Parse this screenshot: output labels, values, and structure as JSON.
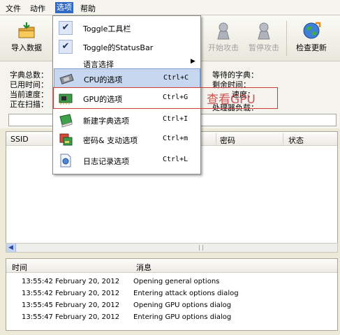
{
  "menubar": {
    "file": "文件",
    "action": "动作",
    "options": "选项",
    "help": "帮助"
  },
  "toolbar": {
    "import": "导入数据",
    "start_attack": "开始攻击",
    "pause_attack": "暂停攻击",
    "check_update": "检查更新"
  },
  "stats": {
    "dict_total": "字典总数：",
    "used_time": "已用时间：",
    "current_speed": "当前速度：",
    "scanning": "正在扫描：",
    "waiting_dict": "等待的字典：",
    "remaining_time": "剩余时间：",
    "total_speed_fragment": "速度：",
    "processor_load_fragment": "处理器负载："
  },
  "grid": {
    "columns": [
      "SSID",
      "密码",
      "状态"
    ]
  },
  "log": {
    "col_time": "时间",
    "col_message": "消息",
    "rows": [
      {
        "time": "13:55:42 February 20, 2012",
        "message": "Opening general options"
      },
      {
        "time": "13:55:42 February 20, 2012",
        "message": "Entering attack options dialog"
      },
      {
        "time": "13:55:45 February 20, 2012",
        "message": "Opening GPU options dialog"
      },
      {
        "time": "13:55:47 February 20, 2012",
        "message": "Entering GPU options dialog"
      }
    ]
  },
  "options_menu": {
    "items": [
      {
        "label": "Toggle工具栏",
        "shortcut": "",
        "checked": true
      },
      {
        "label": "Toggle的StatusBar",
        "shortcut": "",
        "checked": true
      },
      {
        "label": "语言选择",
        "shortcut": "",
        "submenu": true
      },
      {
        "label": "CPU的选项",
        "shortcut": "Ctrl+C",
        "icon": "cpu-chip-icon"
      },
      {
        "label": "GPU的选项",
        "shortcut": "Ctrl+G",
        "icon": "gpu-card-icon"
      },
      {
        "label": "新建字典选项",
        "shortcut": "Ctrl+I",
        "icon": "dictionary-book-icon"
      },
      {
        "label": "密码& 支动选项",
        "shortcut": "Ctrl+m",
        "icon": "password-drive-icon"
      },
      {
        "label": "日志记录选项",
        "shortcut": "Ctrl+L",
        "icon": "log-document-icon"
      }
    ]
  },
  "annotation": "查看GPU",
  "colors": {
    "menu_highlight": "#c8d7f0",
    "menubar_active": "#316ac5",
    "annotation_red": "#d23a3a"
  }
}
